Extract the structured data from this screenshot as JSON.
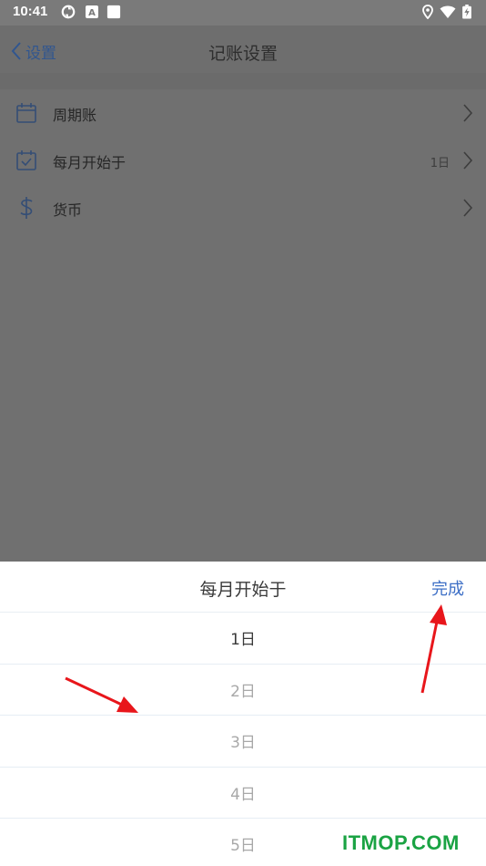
{
  "status_bar": {
    "time": "10:41",
    "icons": [
      "sync-icon",
      "keyboard-a-icon",
      "square-notification-icon",
      "location-icon",
      "wifi-icon",
      "battery-charging-icon"
    ]
  },
  "header": {
    "back_label": "设置",
    "title": "记账设置"
  },
  "settings": {
    "items": [
      {
        "label": "周期账",
        "value": "",
        "icon": "calendar-icon"
      },
      {
        "label": "每月开始于",
        "value": "1日",
        "icon": "calendar-check-icon"
      },
      {
        "label": "货币",
        "value": "",
        "icon": "dollar-icon"
      }
    ]
  },
  "picker": {
    "title": "每月开始于",
    "done_label": "完成",
    "options": [
      "1日",
      "2日",
      "3日",
      "4日",
      "5日"
    ],
    "selected_index": 0
  },
  "watermark": "ITMOP.COM",
  "colors": {
    "accent": "#3d6fc6",
    "overlay": "#707070",
    "annotation_arrow": "#e8161b",
    "watermark": "#1aa343"
  }
}
